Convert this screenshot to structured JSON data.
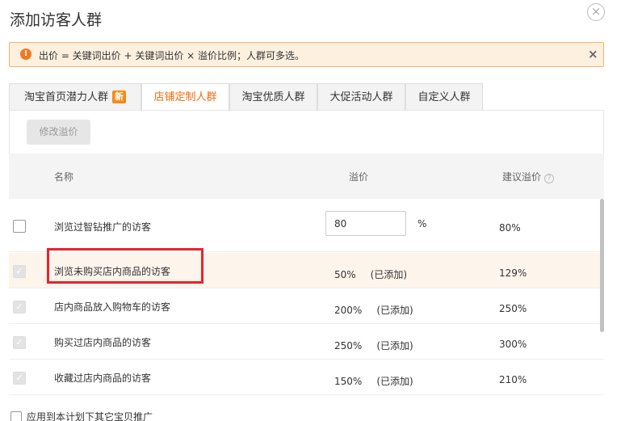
{
  "dialog": {
    "title": "添加访客人群",
    "close_icon": "×"
  },
  "notice": {
    "icon": "!",
    "text": "出价 = 关键词出价 + 关键词出价 × 溢价比例；人群可多选。",
    "close_icon": "×"
  },
  "tabs": [
    {
      "label": "淘宝首页潜力人群",
      "badge": "新",
      "active": false
    },
    {
      "label": "店铺定制人群",
      "active": true
    },
    {
      "label": "淘宝优质人群",
      "active": false
    },
    {
      "label": "大促活动人群",
      "active": false
    },
    {
      "label": "自定义人群",
      "active": false
    }
  ],
  "toolbar": {
    "modify_label": "修改溢价"
  },
  "table": {
    "headers": {
      "name": "名称",
      "premium": "溢价",
      "suggested": "建议溢价",
      "help_icon": "?"
    },
    "rows": [
      {
        "name": "浏览过智钻推广的访客",
        "premium_input": "80",
        "unit": "%",
        "suggested": "80%",
        "checked": false
      },
      {
        "name": "浏览未购买店内商品的访客",
        "premium": "50%",
        "status": "(已添加)",
        "suggested": "129%",
        "checked": true
      },
      {
        "name": "店内商品放入购物车的访客",
        "premium": "200%",
        "status": "(已添加)",
        "suggested": "250%",
        "checked": true
      },
      {
        "name": "购买过店内商品的访客",
        "premium": "250%",
        "status": "(已添加)",
        "suggested": "300%",
        "checked": true
      },
      {
        "name": "收藏过店内商品的访客",
        "premium": "150%",
        "status": "(已添加)",
        "suggested": "210%",
        "checked": true
      }
    ]
  },
  "footer": {
    "apply_label": "应用到本计划下其它宝贝推广"
  },
  "colors": {
    "accent": "#f06a0f",
    "notice_bg": "#fdf0de",
    "notice_border": "#f3b36b",
    "highlight_box": "#e8232a"
  }
}
